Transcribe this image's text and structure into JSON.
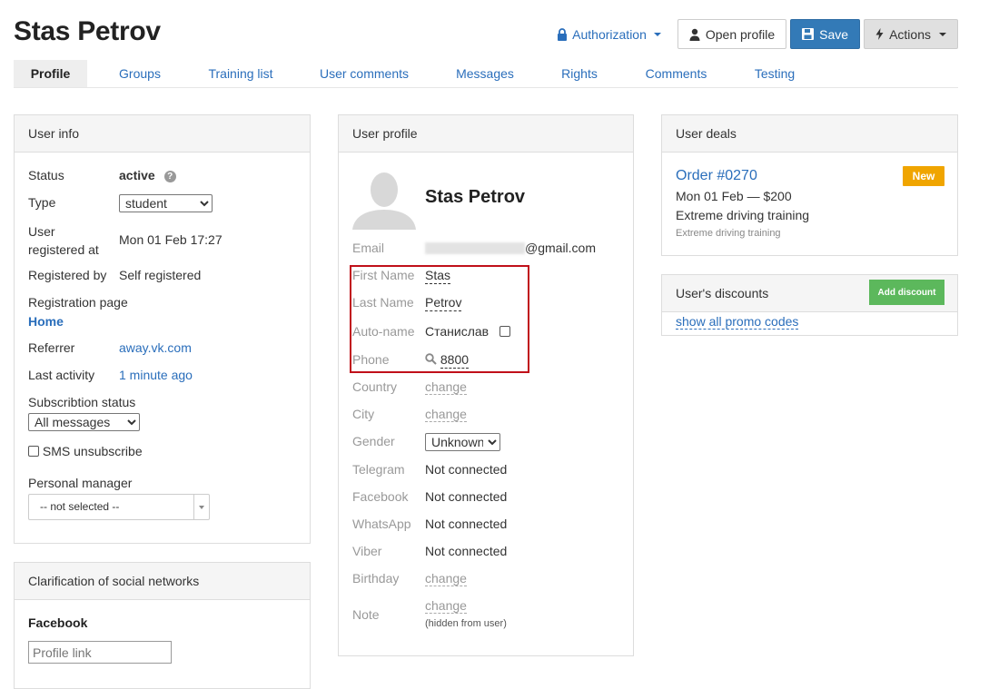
{
  "header": {
    "title": "Stas Petrov",
    "authorization_label": "Authorization",
    "open_profile_label": "Open profile",
    "save_label": "Save",
    "actions_label": "Actions"
  },
  "tabs": [
    {
      "label": "Profile"
    },
    {
      "label": "Groups"
    },
    {
      "label": "Training list"
    },
    {
      "label": "User comments"
    },
    {
      "label": "Messages"
    },
    {
      "label": "Rights"
    },
    {
      "label": "Comments"
    },
    {
      "label": "Testing"
    }
  ],
  "user_info": {
    "title": "User info",
    "status_label": "Status",
    "status_value": "active",
    "type_label": "Type",
    "type_value": "student",
    "registered_at_label": "User registered at",
    "registered_at_value": "Mon 01 Feb 17:27",
    "registered_by_label": "Registered by",
    "registered_by_value": "Self registered",
    "registration_page_label": "Registration page",
    "registration_page_value": "Home",
    "referrer_label": "Referrer",
    "referrer_value": "away.vk.com",
    "last_activity_label": "Last activity",
    "last_activity_value": "1 minute ago",
    "subscription_label": "Subscribtion status",
    "subscription_value": "All messages",
    "sms_unsubscribe_label": "SMS unsubscribe",
    "manager_label": "Personal manager",
    "manager_value": "-- not selected --"
  },
  "social": {
    "title": "Clarification of social networks",
    "facebook_label": "Facebook",
    "profile_link_placeholder": "Profile link"
  },
  "user_profile": {
    "title": "User profile",
    "name": "Stas Petrov",
    "email_label": "Email",
    "email_domain": "@gmail.com",
    "first_name_label": "First Name",
    "first_name_value": "Stas",
    "last_name_label": "Last Name",
    "last_name_value": "Petrov",
    "auto_name_label": "Auto-name",
    "auto_name_value": "Станислав",
    "phone_label": "Phone",
    "phone_value": "8800",
    "country_label": "Country",
    "city_label": "City",
    "change_label": "change",
    "gender_label": "Gender",
    "gender_value": "Unknown",
    "telegram_label": "Telegram",
    "facebook_label": "Facebook",
    "whatsapp_label": "WhatsApp",
    "viber_label": "Viber",
    "not_connected": "Not connected",
    "birthday_label": "Birthday",
    "note_label": "Note",
    "note_hint": "(hidden from user)"
  },
  "deals": {
    "title": "User deals",
    "order_label": "Order #0270",
    "order_meta": "Mon 01 Feb — $200",
    "order_product": "Extreme driving training",
    "order_product_sub": "Extreme driving training",
    "badge": "New"
  },
  "discounts": {
    "title": "User's discounts",
    "add_label": "Add discount",
    "promo_link": "show all promo codes"
  },
  "colors": {
    "accent": "#2a6ebb",
    "primary_button": "#337ab7",
    "badge_new": "#f0a500",
    "add_discount": "#5cb85c",
    "highlight_box": "#c0101a"
  }
}
